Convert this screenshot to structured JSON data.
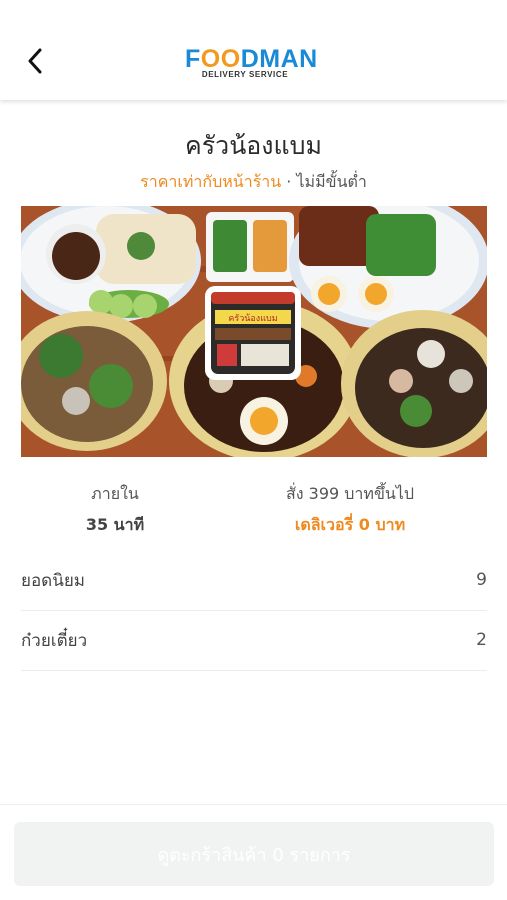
{
  "header": {
    "back_icon": "chevron-left-icon",
    "logo": {
      "main": "FOODMAN",
      "sub": "DELIVERY SERVICE",
      "colors": {
        "blue": "#1a8ad6",
        "orange": "#f29a1f"
      }
    }
  },
  "shop": {
    "name": "ครัวน้องแบม",
    "price_tag": "ราคาเท่ากับหน้าร้าน",
    "separator": " · ",
    "min_order": "ไม่มีขั้นต่ำ",
    "banner_sign_text": "ครัวน้องแบม"
  },
  "delivery_info": {
    "time_label": "ภายใน",
    "time_value": "35 นาที",
    "free_label": "สั่ง 399 บาทขึ้นไป",
    "free_value": "เดลิเวอรี่ 0 บาท"
  },
  "categories": [
    {
      "label": "ยอดนิยม",
      "count": "9"
    },
    {
      "label": "ก๋วยเตี๋ยว",
      "count": "2"
    }
  ],
  "cart_button": {
    "label": "ดูตะกร้าสินค้า 0 รายการ"
  },
  "colors": {
    "accent": "#ef8a1f",
    "button_bg": "#f1f2f2"
  }
}
